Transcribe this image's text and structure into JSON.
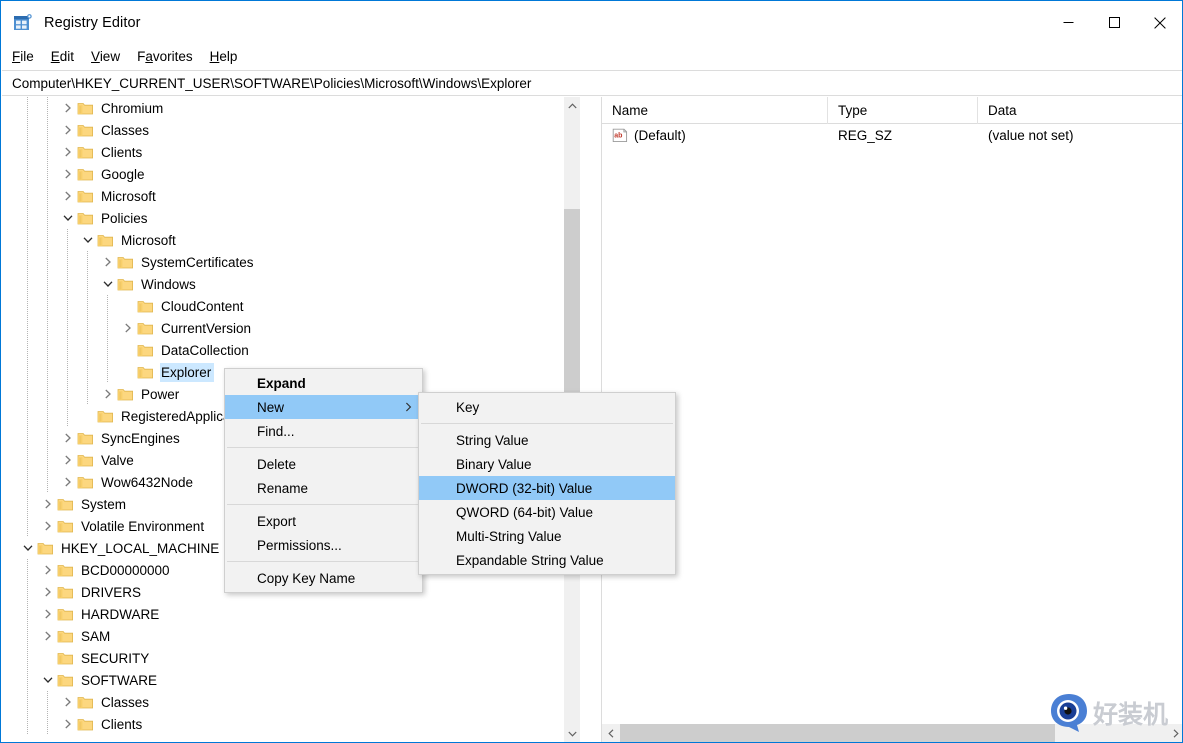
{
  "window": {
    "title": "Registry Editor",
    "icon": "registry-editor-icon",
    "accent_color": "#0078d7",
    "controls": [
      {
        "name": "minimize",
        "glyph": "minimize-icon"
      },
      {
        "name": "maximize",
        "glyph": "maximize-icon"
      },
      {
        "name": "close",
        "glyph": "close-icon"
      }
    ]
  },
  "menubar": {
    "items": [
      {
        "label": "File",
        "accel": "F"
      },
      {
        "label": "Edit",
        "accel": "E"
      },
      {
        "label": "View",
        "accel": "V"
      },
      {
        "label": "Favorites",
        "accel": "a"
      },
      {
        "label": "Help",
        "accel": "H"
      }
    ]
  },
  "addressbar": {
    "path": "Computer\\HKEY_CURRENT_USER\\SOFTWARE\\Policies\\Microsoft\\Windows\\Explorer"
  },
  "tree": {
    "rows": [
      {
        "label": "Chromium",
        "depth": 2,
        "chevron": "collapsed",
        "selected": false
      },
      {
        "label": "Classes",
        "depth": 2,
        "chevron": "collapsed",
        "selected": false
      },
      {
        "label": "Clients",
        "depth": 2,
        "chevron": "collapsed",
        "selected": false
      },
      {
        "label": "Google",
        "depth": 2,
        "chevron": "collapsed",
        "selected": false
      },
      {
        "label": "Microsoft",
        "depth": 2,
        "chevron": "collapsed",
        "selected": false
      },
      {
        "label": "Policies",
        "depth": 2,
        "chevron": "expanded",
        "selected": false
      },
      {
        "label": "Microsoft",
        "depth": 3,
        "chevron": "expanded",
        "selected": false
      },
      {
        "label": "SystemCertificates",
        "depth": 4,
        "chevron": "collapsed",
        "selected": false
      },
      {
        "label": "Windows",
        "depth": 4,
        "chevron": "expanded",
        "selected": false
      },
      {
        "label": "CloudContent",
        "depth": 5,
        "chevron": "none",
        "selected": false
      },
      {
        "label": "CurrentVersion",
        "depth": 5,
        "chevron": "collapsed",
        "selected": false
      },
      {
        "label": "DataCollection",
        "depth": 5,
        "chevron": "none",
        "selected": false
      },
      {
        "label": "Explorer",
        "depth": 5,
        "chevron": "none",
        "selected": true
      },
      {
        "label": "Power",
        "depth": 4,
        "chevron": "collapsed",
        "selected": false
      },
      {
        "label": "RegisteredApplications",
        "depth": 3,
        "chevron": "none",
        "selected": false
      },
      {
        "label": "SyncEngines",
        "depth": 2,
        "chevron": "collapsed",
        "selected": false
      },
      {
        "label": "Valve",
        "depth": 2,
        "chevron": "collapsed",
        "selected": false
      },
      {
        "label": "Wow6432Node",
        "depth": 2,
        "chevron": "collapsed",
        "selected": false
      },
      {
        "label": "System",
        "depth": 1,
        "chevron": "collapsed",
        "selected": false
      },
      {
        "label": "Volatile Environment",
        "depth": 1,
        "chevron": "collapsed",
        "selected": false
      },
      {
        "label": "HKEY_LOCAL_MACHINE",
        "depth": 0,
        "chevron": "expanded",
        "selected": false
      },
      {
        "label": "BCD00000000",
        "depth": 1,
        "chevron": "collapsed",
        "selected": false
      },
      {
        "label": "DRIVERS",
        "depth": 1,
        "chevron": "collapsed",
        "selected": false
      },
      {
        "label": "HARDWARE",
        "depth": 1,
        "chevron": "collapsed",
        "selected": false
      },
      {
        "label": "SAM",
        "depth": 1,
        "chevron": "collapsed",
        "selected": false
      },
      {
        "label": "SECURITY",
        "depth": 1,
        "chevron": "none",
        "selected": false
      },
      {
        "label": "SOFTWARE",
        "depth": 1,
        "chevron": "expanded",
        "selected": false
      },
      {
        "label": "Classes",
        "depth": 2,
        "chevron": "collapsed",
        "selected": false
      },
      {
        "label": "Clients",
        "depth": 2,
        "chevron": "collapsed",
        "selected": false
      }
    ]
  },
  "list": {
    "columns": [
      {
        "label": "Name"
      },
      {
        "label": "Type"
      },
      {
        "label": "Data"
      }
    ],
    "rows": [
      {
        "name": "(Default)",
        "type": "REG_SZ",
        "data": "(value not set)",
        "icon": "string-value-icon"
      }
    ]
  },
  "context_menu": {
    "items": [
      {
        "label": "Expand",
        "bold": true,
        "highlighted": false,
        "submenu": false,
        "separator_after": false
      },
      {
        "label": "New",
        "bold": false,
        "highlighted": true,
        "submenu": true,
        "separator_after": false
      },
      {
        "label": "Find...",
        "bold": false,
        "highlighted": false,
        "submenu": false,
        "separator_after": true
      },
      {
        "label": "Delete",
        "bold": false,
        "highlighted": false,
        "submenu": false,
        "separator_after": false
      },
      {
        "label": "Rename",
        "bold": false,
        "highlighted": false,
        "submenu": false,
        "separator_after": true
      },
      {
        "label": "Export",
        "bold": false,
        "highlighted": false,
        "submenu": false,
        "separator_after": false
      },
      {
        "label": "Permissions...",
        "bold": false,
        "highlighted": false,
        "submenu": false,
        "separator_after": true
      },
      {
        "label": "Copy Key Name",
        "bold": false,
        "highlighted": false,
        "submenu": false,
        "separator_after": false
      }
    ],
    "highlight_color": "#91c9f7"
  },
  "submenu": {
    "items": [
      {
        "label": "Key",
        "highlighted": false,
        "separator_after": true
      },
      {
        "label": "String Value",
        "highlighted": false,
        "separator_after": false
      },
      {
        "label": "Binary Value",
        "highlighted": false,
        "separator_after": false
      },
      {
        "label": "DWORD (32-bit) Value",
        "highlighted": true,
        "separator_after": false
      },
      {
        "label": "QWORD (64-bit) Value",
        "highlighted": false,
        "separator_after": false
      },
      {
        "label": "Multi-String Value",
        "highlighted": false,
        "separator_after": false
      },
      {
        "label": "Expandable String Value",
        "highlighted": false,
        "separator_after": false
      }
    ]
  },
  "watermark": {
    "text": "好装机",
    "icon": "eye-logo-icon"
  }
}
